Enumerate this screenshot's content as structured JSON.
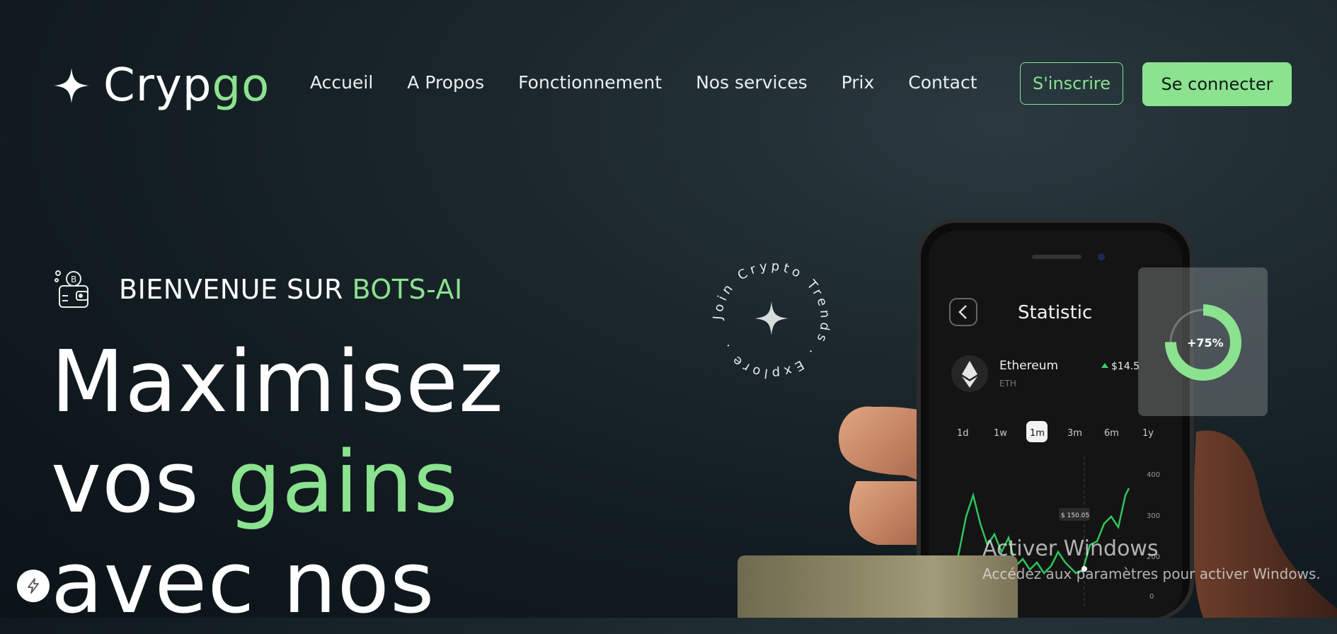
{
  "nav": {
    "logo_main": "Cryp",
    "logo_accent": "go",
    "menu": [
      "Accueil",
      "A Propos",
      "Fonctionnement",
      "Nos services",
      "Prix",
      "Contact"
    ],
    "signup_label": "S'inscrire",
    "login_label": "Se connecter"
  },
  "hero": {
    "welcome_prefix": "BIENVENUE SUR ",
    "welcome_accent": "BOTS-AI",
    "line1": "Maximisez",
    "line2_prefix": "vos ",
    "line2_accent": "gains",
    "line3": "avec nos"
  },
  "badge": {
    "circular_text": "Join Crypto Trends . Explore ."
  },
  "phone": {
    "title": "Statistic",
    "coin_name": "Ethereum",
    "coin_symbol": "ETH",
    "coin_price": "$14.5",
    "ranges": [
      "1d",
      "1w",
      "1m",
      "3m",
      "6m",
      "1y"
    ],
    "active_range": "1m",
    "tooltip": "$ 150.05",
    "y_ticks": [
      "400",
      "300",
      "200",
      "0"
    ],
    "gauge_label": "+75%"
  },
  "windows": {
    "title": "Activer Windows",
    "subtitle": "Accédez aux paramètres pour activer Windows."
  },
  "colors": {
    "accent": "#8be28f",
    "background": "#15222a"
  }
}
